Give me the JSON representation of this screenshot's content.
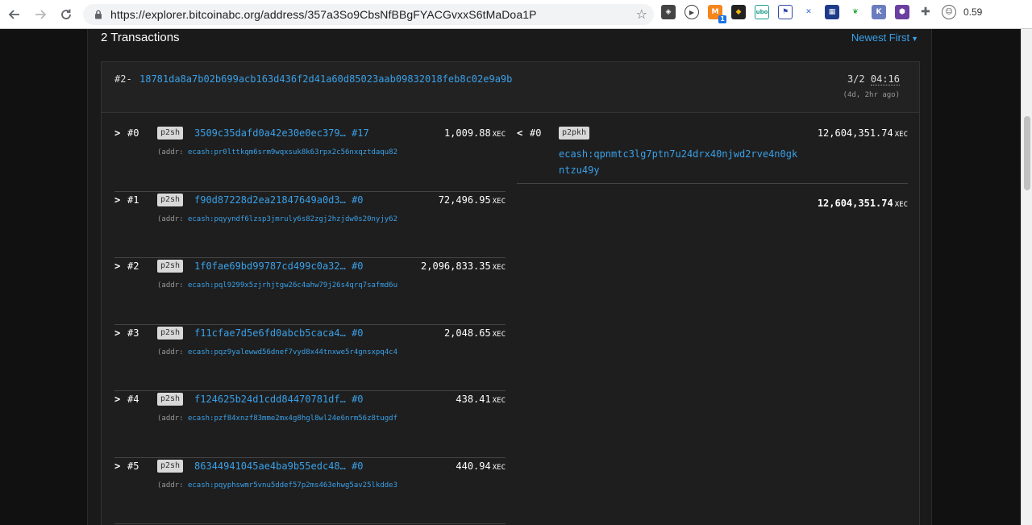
{
  "browser": {
    "url": "https://explorer.bitcoinabc.org/address/357a3So9CbsNfBBgFYACGvxxS6tMaDoa1P",
    "extension_badge": "1",
    "profile_label": "0.59"
  },
  "page": {
    "tx_count_label": "2 Transactions",
    "sort_label": "Newest First"
  },
  "transaction": {
    "index": "#2-",
    "hash": "18781da8a7b02b699acb163d436f2d41a60d85023aab09832018feb8c02e9a9b",
    "date": "3/2",
    "time": "04:16",
    "ago": "(4d, 2hr ago)",
    "inputs": [
      {
        "arrow": ">",
        "num": "#0",
        "type": "p2sh",
        "txid": "3509c35dafd0a42e30e0ec379…",
        "vout": "#17",
        "amount": "1,009.88",
        "unit": "XEC",
        "addr_prefix": "(addr:",
        "addr": "ecash:pr0lttkqm6srm9wqxsuk8k63rpx2c56nxqztdaqu82"
      },
      {
        "arrow": ">",
        "num": "#1",
        "type": "p2sh",
        "txid": "f90d87228d2ea21847649a0d3…",
        "vout": "#0",
        "amount": "72,496.95",
        "unit": "XEC",
        "addr_prefix": "(addr:",
        "addr": "ecash:pqyyndf6lzsp3jmruly6s82zgj2hzjdw0s20nyjy62"
      },
      {
        "arrow": ">",
        "num": "#2",
        "type": "p2sh",
        "txid": "1f0fae69bd99787cd499c0a32…",
        "vout": "#0",
        "amount": "2,096,833.35",
        "unit": "XEC",
        "addr_prefix": "(addr:",
        "addr": "ecash:pql9299x5zjrhjtgw26c4ahw79j26s4qrq7safmd6u"
      },
      {
        "arrow": ">",
        "num": "#3",
        "type": "p2sh",
        "txid": "f11cfae7d5e6fd0abcb5caca4…",
        "vout": "#0",
        "amount": "2,048.65",
        "unit": "XEC",
        "addr_prefix": "(addr:",
        "addr": "ecash:pqz9yalewwd56dnef7vyd8x44tnxwe5r4gnsxpq4c4"
      },
      {
        "arrow": ">",
        "num": "#4",
        "type": "p2sh",
        "txid": "f124625b24d1cdd84470781df…",
        "vout": "#0",
        "amount": "438.41",
        "unit": "XEC",
        "addr_prefix": "(addr:",
        "addr": "ecash:pzf84xnzf83mme2mx4g8hgl8wl24e6nrm56z8tugdf"
      },
      {
        "arrow": ">",
        "num": "#5",
        "type": "p2sh",
        "txid": "86344941045ae4ba9b55edc48…",
        "vout": "#0",
        "amount": "440.94",
        "unit": "XEC",
        "addr_prefix": "(addr:",
        "addr": "ecash:pqyphswmr5vnu5ddef57p2ms463ehwg5av25lkdde3"
      }
    ],
    "outputs": [
      {
        "arrow": "<",
        "num": "#0",
        "type": "p2pkh",
        "addr": "ecash:qpnmtc3lg7ptn7u24drx40njwd2rve4n0gkntzu49y",
        "amount": "12,604,351.74",
        "unit": "XEC"
      }
    ],
    "total": {
      "amount": "12,604,351.74",
      "unit": "XEC"
    }
  },
  "colors": {
    "link": "#3aa0e8",
    "background": "#1a1a1a"
  }
}
